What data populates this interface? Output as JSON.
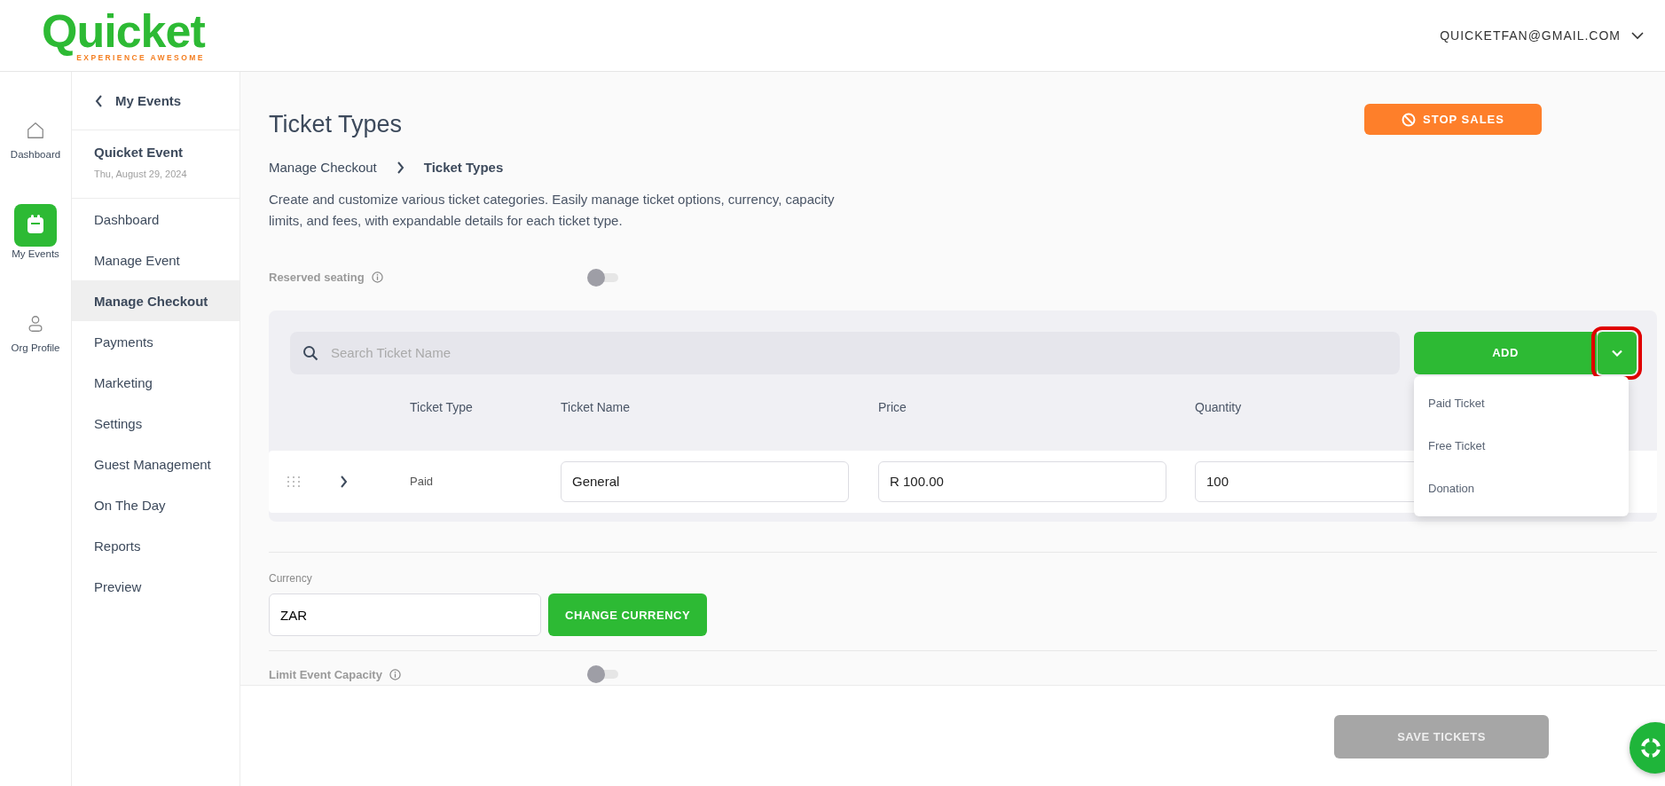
{
  "header": {
    "logo": {
      "name": "Quicket",
      "tagline": "EXPERIENCE AWESOME"
    },
    "account": "QUICKETFAN@GMAIL.COM"
  },
  "rail": [
    {
      "kind": "home",
      "label": "Dashboard",
      "selected": false
    },
    {
      "kind": "calendar",
      "label": "My Events",
      "selected": true
    },
    {
      "kind": "person",
      "label": "Org Profile",
      "selected": false
    }
  ],
  "sidebar": {
    "back": "My Events",
    "event": {
      "name": "Quicket Event",
      "date": "Thu, August 29, 2024"
    },
    "items": [
      {
        "label": "Dashboard",
        "selected": false
      },
      {
        "label": "Manage Event",
        "selected": false
      },
      {
        "label": "Manage Checkout",
        "selected": true
      },
      {
        "label": "Payments",
        "selected": false
      },
      {
        "label": "Marketing",
        "selected": false
      },
      {
        "label": "Settings",
        "selected": false
      },
      {
        "label": "Guest Management",
        "selected": false
      },
      {
        "label": "On The Day",
        "selected": false
      },
      {
        "label": "Reports",
        "selected": false
      },
      {
        "label": "Preview",
        "selected": false
      }
    ]
  },
  "page": {
    "title": "Ticket Types",
    "stop_sales": "STOP SALES",
    "breadcrumb": [
      "Manage Checkout",
      "Ticket Types"
    ],
    "description": "Create and customize various ticket categories. Easily manage ticket options, currency, capacity limits, and fees, with expandable details for each ticket type."
  },
  "reserved_seating": {
    "label": "Reserved seating",
    "on": false
  },
  "tickets": {
    "search": {
      "placeholder": "Search Ticket Name"
    },
    "add_button": {
      "label": "ADD",
      "expanded": true,
      "highlighted": true,
      "menu": [
        "Paid Ticket",
        "Free Ticket",
        "Donation"
      ]
    },
    "columns": [
      "Ticket Type",
      "Ticket Name",
      "Price",
      "Quantity"
    ],
    "rows": [
      {
        "type": "Paid",
        "name": "General",
        "price": "R 100.00",
        "quantity": "100",
        "expanded": false
      }
    ]
  },
  "currency": {
    "label": "Currency",
    "value": "ZAR",
    "button": "CHANGE CURRENCY"
  },
  "limit_capacity": {
    "label": "Limit Event Capacity",
    "on": false
  },
  "footer": {
    "save": "SAVE TICKETS",
    "disabled": true
  }
}
